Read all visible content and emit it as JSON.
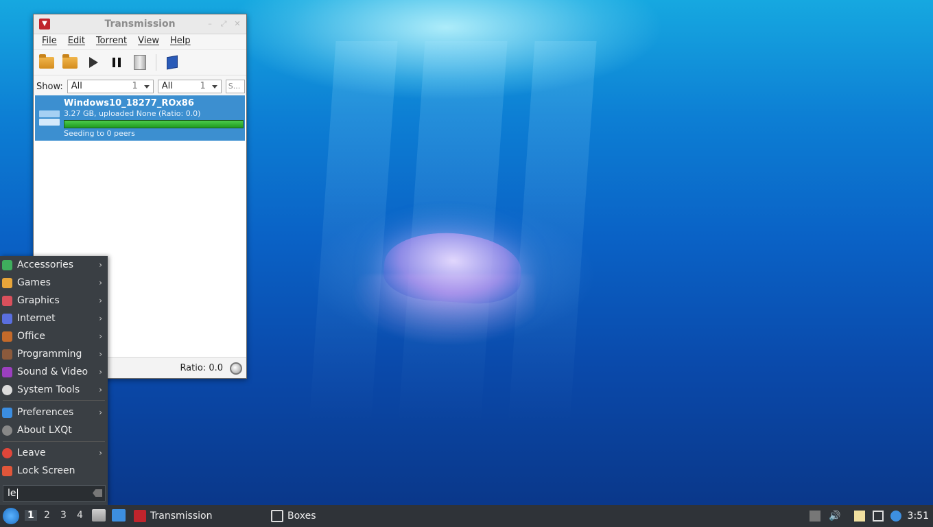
{
  "window": {
    "title": "Transmission",
    "menu": [
      "File",
      "Edit",
      "Torrent",
      "View",
      "Help"
    ],
    "filter": {
      "show_label": "Show:",
      "activity_value": "All",
      "activity_count": "1",
      "tracker_value": "All",
      "tracker_count": "1",
      "search_placeholder": "S..."
    },
    "torrent": {
      "name": "Windows10_18277_ROx86",
      "size_text": "3.27 GB, uploaded None (Ratio: 0.0)",
      "progress": 1.0,
      "status": "Seeding to 0 peers"
    },
    "status_ratio": "Ratio: 0.0"
  },
  "app_menu": {
    "items": [
      {
        "label": "Accessories",
        "icon": "accessories-icon",
        "color": "#3fae5d",
        "submenu": true
      },
      {
        "label": "Games",
        "icon": "games-icon",
        "color": "#e8a53a",
        "submenu": true
      },
      {
        "label": "Graphics",
        "icon": "graphics-icon",
        "color": "#d8505c",
        "submenu": true
      },
      {
        "label": "Internet",
        "icon": "internet-icon",
        "color": "#5a6fe0",
        "submenu": true
      },
      {
        "label": "Office",
        "icon": "office-icon",
        "color": "#c46a2a",
        "submenu": true
      },
      {
        "label": "Programming",
        "icon": "programming-icon",
        "color": "#8b5a3c",
        "submenu": true
      },
      {
        "label": "Sound & Video",
        "icon": "sound-video-icon",
        "color": "#9b3fbf",
        "submenu": true
      },
      {
        "label": "System Tools",
        "icon": "system-tools-icon",
        "color": "#dcdcdc",
        "submenu": true
      },
      {
        "label": "Preferences",
        "icon": "preferences-icon",
        "color": "#3b8de0",
        "submenu": true
      },
      {
        "label": "About LXQt",
        "icon": "about-icon",
        "color": "#888888",
        "submenu": false
      },
      {
        "label": "Leave",
        "icon": "leave-icon",
        "color": "#e0463a",
        "submenu": true
      },
      {
        "label": "Lock Screen",
        "icon": "lock-icon",
        "color": "#e0563a",
        "submenu": false
      }
    ],
    "search_value": "le"
  },
  "taskbar": {
    "desktops": [
      "1",
      "2",
      "3",
      "4"
    ],
    "active_desktop": "1",
    "tasks": [
      "Transmission",
      "Boxes"
    ],
    "clock": "3:51"
  }
}
